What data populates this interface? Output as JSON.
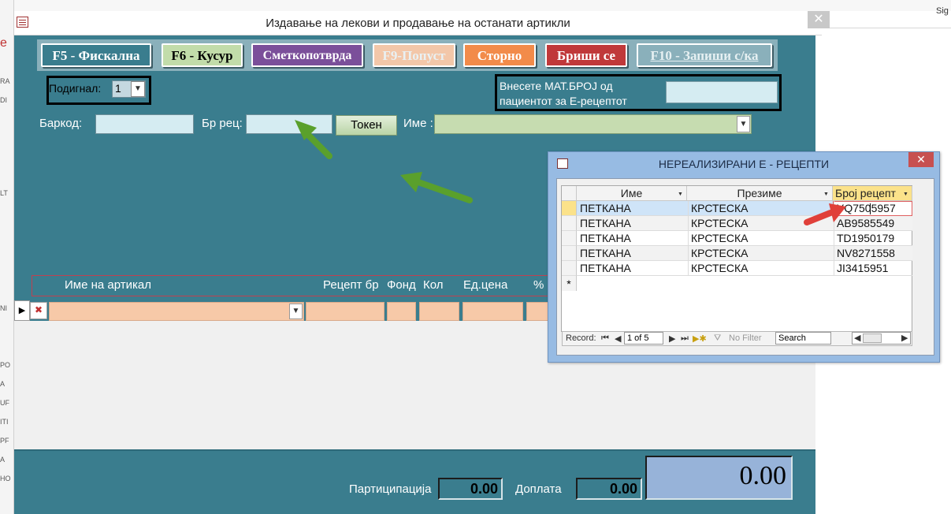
{
  "background": {
    "top_right": "Sig",
    "left_letters": [
      "е",
      "RA",
      "DI",
      "LT",
      "NI",
      "PO",
      "A",
      "UF",
      "ITI",
      "PF",
      "A",
      "HO"
    ]
  },
  "form": {
    "title": "Издавање на лекови и продавање на останати артикли",
    "close_icon": "close-icon",
    "toolbar": {
      "f5": "F5 - Фискална",
      "f6": "F6 - Кусур",
      "smet": "Сметкопотврда",
      "f9": "F9-Попуст",
      "storno": "Сторно",
      "brisi": "Бриши се",
      "f10": "F10 - Запиши с/ка"
    },
    "podignal": {
      "label": "Подигнал:",
      "value": "1"
    },
    "mat": {
      "label": "Внесете МАТ.БРОЈ од пациентот за Е-рецептот",
      "value": ""
    },
    "barkod": {
      "label": "Баркод:",
      "value": ""
    },
    "br_rec": {
      "label": "Бр рец:",
      "value": ""
    },
    "token_label": "Токен",
    "ime": {
      "label": "Име :",
      "value": ""
    },
    "articles": {
      "headers": {
        "name": "Име на артикал",
        "rec": "Рецепт бр",
        "fond": "Фонд",
        "kol": "Кол",
        "cena": "Ед.цена",
        "pct": "%"
      },
      "row_selector": "▶"
    },
    "footer": {
      "participation_label": "Партиципација",
      "participation_value": "0.00",
      "doplata_label": "Доплата",
      "doplata_value": "0.00",
      "total_value": "0.00"
    }
  },
  "popup": {
    "title": "НЕРЕАЛИЗИРАНИ Е - РЕЦЕПТИ",
    "close": "✕",
    "columns": {
      "ime": "Име",
      "prezime": "Презиме",
      "broj": "Број рецепт"
    },
    "rows": [
      {
        "ime": "ПЕТКАНА",
        "prezime": "КРСТЕСКА",
        "broj": "YQ7505957"
      },
      {
        "ime": "ПЕТКАНА",
        "prezime": "КРСТЕСКА",
        "broj": "AB9585549"
      },
      {
        "ime": "ПЕТКАНА",
        "prezime": "КРСТЕСКА",
        "broj": "TD1950179"
      },
      {
        "ime": "ПЕТКАНА",
        "prezime": "КРСТЕСКА",
        "broj": "NV8271558"
      },
      {
        "ime": "ПЕТКАНА",
        "prezime": "КРСТЕСКА",
        "broj": "JI3415951"
      }
    ],
    "new_row": "*",
    "nav": {
      "record_label": "Record:",
      "position": "1 of 5",
      "no_filter": "No Filter",
      "search": "Search"
    }
  },
  "colors": {
    "teal": "#3a7d8e",
    "arrow_green": "#5aa02c",
    "arrow_red": "#e0403a"
  }
}
